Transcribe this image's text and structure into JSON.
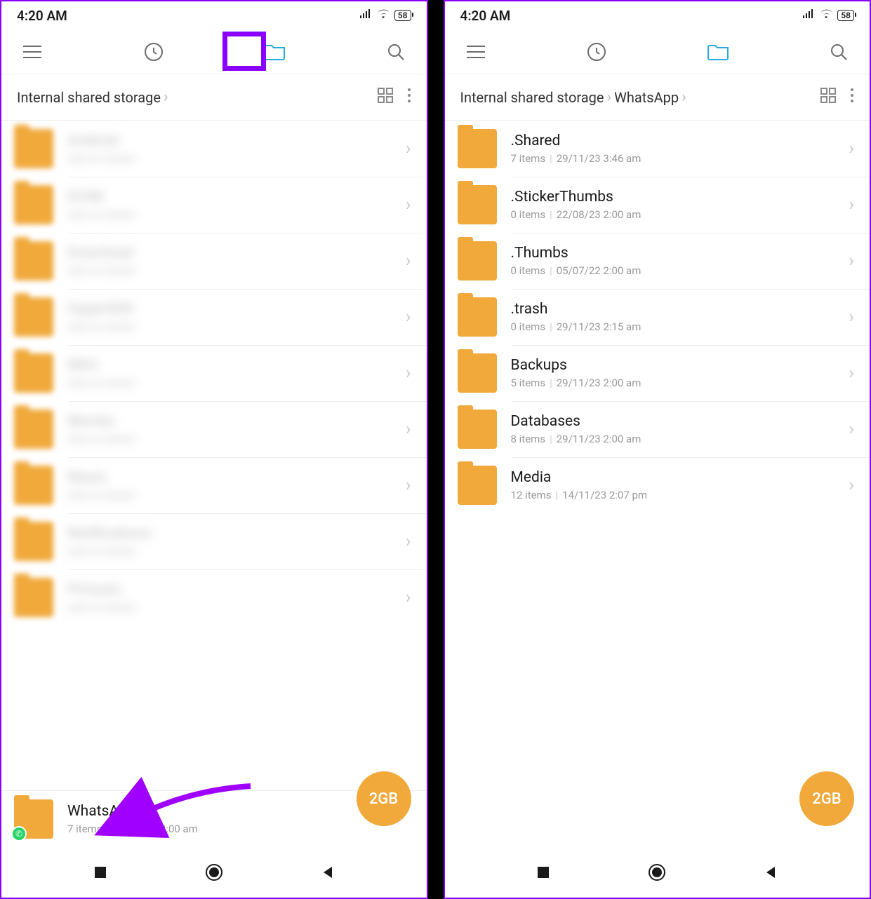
{
  "statusbar": {
    "time": "4:20 AM",
    "battery": "58"
  },
  "fab_label": "2GB",
  "left": {
    "breadcrumb": [
      "Internal shared storage"
    ],
    "whatsapp_row": {
      "name": "WhatsApp",
      "items": "7 items",
      "date": "15/11/23 2:00 am"
    }
  },
  "right": {
    "breadcrumb": [
      "Internal shared storage",
      "WhatsApp"
    ],
    "rows": [
      {
        "name": ".Shared",
        "items": "7 items",
        "date": "29/11/23 3:46 am"
      },
      {
        "name": ".StickerThumbs",
        "items": "0 items",
        "date": "22/08/23 2:00 am"
      },
      {
        "name": ".Thumbs",
        "items": "0 items",
        "date": "05/07/22 2:00 am"
      },
      {
        "name": ".trash",
        "items": "0 items",
        "date": "29/11/23 2:15 am"
      },
      {
        "name": "Backups",
        "items": "5 items",
        "date": "29/11/23 2:00 am"
      },
      {
        "name": "Databases",
        "items": "8 items",
        "date": "29/11/23 2:00 am"
      },
      {
        "name": "Media",
        "items": "12 items",
        "date": "14/11/23 2:07 pm"
      }
    ]
  }
}
